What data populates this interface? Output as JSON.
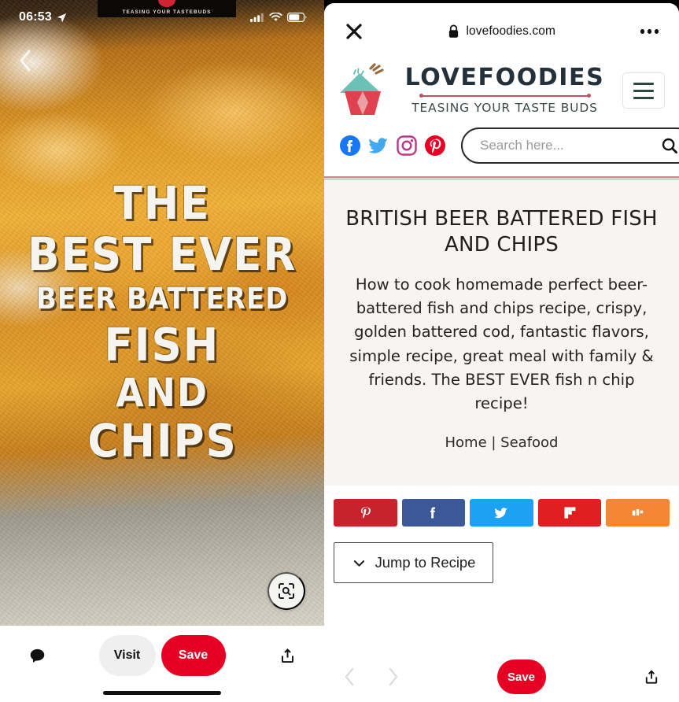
{
  "pin": {
    "status_bar": {
      "time": "06:53",
      "location_icon": "location-arrow-icon",
      "signal_icon": "cellular-signal-icon",
      "wifi_icon": "wifi-icon",
      "battery_icon": "battery-icon"
    },
    "back_icon": "back-chevron-icon",
    "image_banner_text": "TEASING YOUR TASTEBUDS",
    "overlay_lines": [
      "THE",
      "BEST EVER",
      "BEER BATTERED",
      "FISH",
      "AND",
      "CHIPS"
    ],
    "lens_icon": "visual-search-icon",
    "bottom_bar": {
      "comment_icon": "comment-bubble-icon",
      "visit_label": "Visit",
      "save_label": "Save",
      "share_icon": "share-upload-icon"
    }
  },
  "browser": {
    "close_icon": "close-x-icon",
    "lock_icon": "lock-icon",
    "url": "lovefoodies.com",
    "more_icon": "more-options-icon",
    "bottom_bar": {
      "back_icon": "chevron-left-icon",
      "forward_icon": "chevron-right-icon",
      "save_label": "Save",
      "share_icon": "share-upload-icon"
    }
  },
  "site": {
    "logo_icon": "lovefoodies-cupcake-logo-icon",
    "logo_word": "LOVEFOODIES",
    "tagline": "TEASING YOUR TASTE BUDS",
    "menu_icon": "hamburger-menu-icon",
    "social": [
      {
        "name": "facebook-icon",
        "color": "#1877F2"
      },
      {
        "name": "twitter-icon",
        "color": "#40A9F0"
      },
      {
        "name": "instagram-icon",
        "color": "#C13584"
      },
      {
        "name": "pinterest-icon",
        "color": "#E60023"
      }
    ],
    "search": {
      "placeholder": "Search here...",
      "value": "",
      "icon": "search-magnifier-icon"
    },
    "article": {
      "title": "BRITISH BEER BATTERED FISH AND CHIPS",
      "description": "How to cook homemade perfect beer-battered fish and chips recipe, crispy, golden battered cod, fantastic flavors, simple recipe, great meal with family & friends. The BEST EVER fish n chip recipe!",
      "breadcrumb": "Home | Seafood"
    },
    "share_buttons": [
      {
        "name": "pinterest-share-button",
        "icon": "pinterest-icon",
        "color": "#C8232C"
      },
      {
        "name": "facebook-share-button",
        "icon": "facebook-icon",
        "color": "#3B5998"
      },
      {
        "name": "twitter-share-button",
        "icon": "twitter-icon",
        "color": "#1DA1F2"
      },
      {
        "name": "flipboard-share-button",
        "icon": "flipboard-icon",
        "color": "#E02020"
      },
      {
        "name": "mix-share-button",
        "icon": "mix-icon",
        "color": "#F58634"
      }
    ],
    "jump_to_recipe": {
      "label": "Jump to Recipe",
      "icon": "chevron-down-icon"
    }
  },
  "colors": {
    "pinterest_red": "#e60023",
    "header_rule": "#c98a90",
    "article_bg": "#f7f4f1",
    "logo_dark": "#24303a"
  }
}
